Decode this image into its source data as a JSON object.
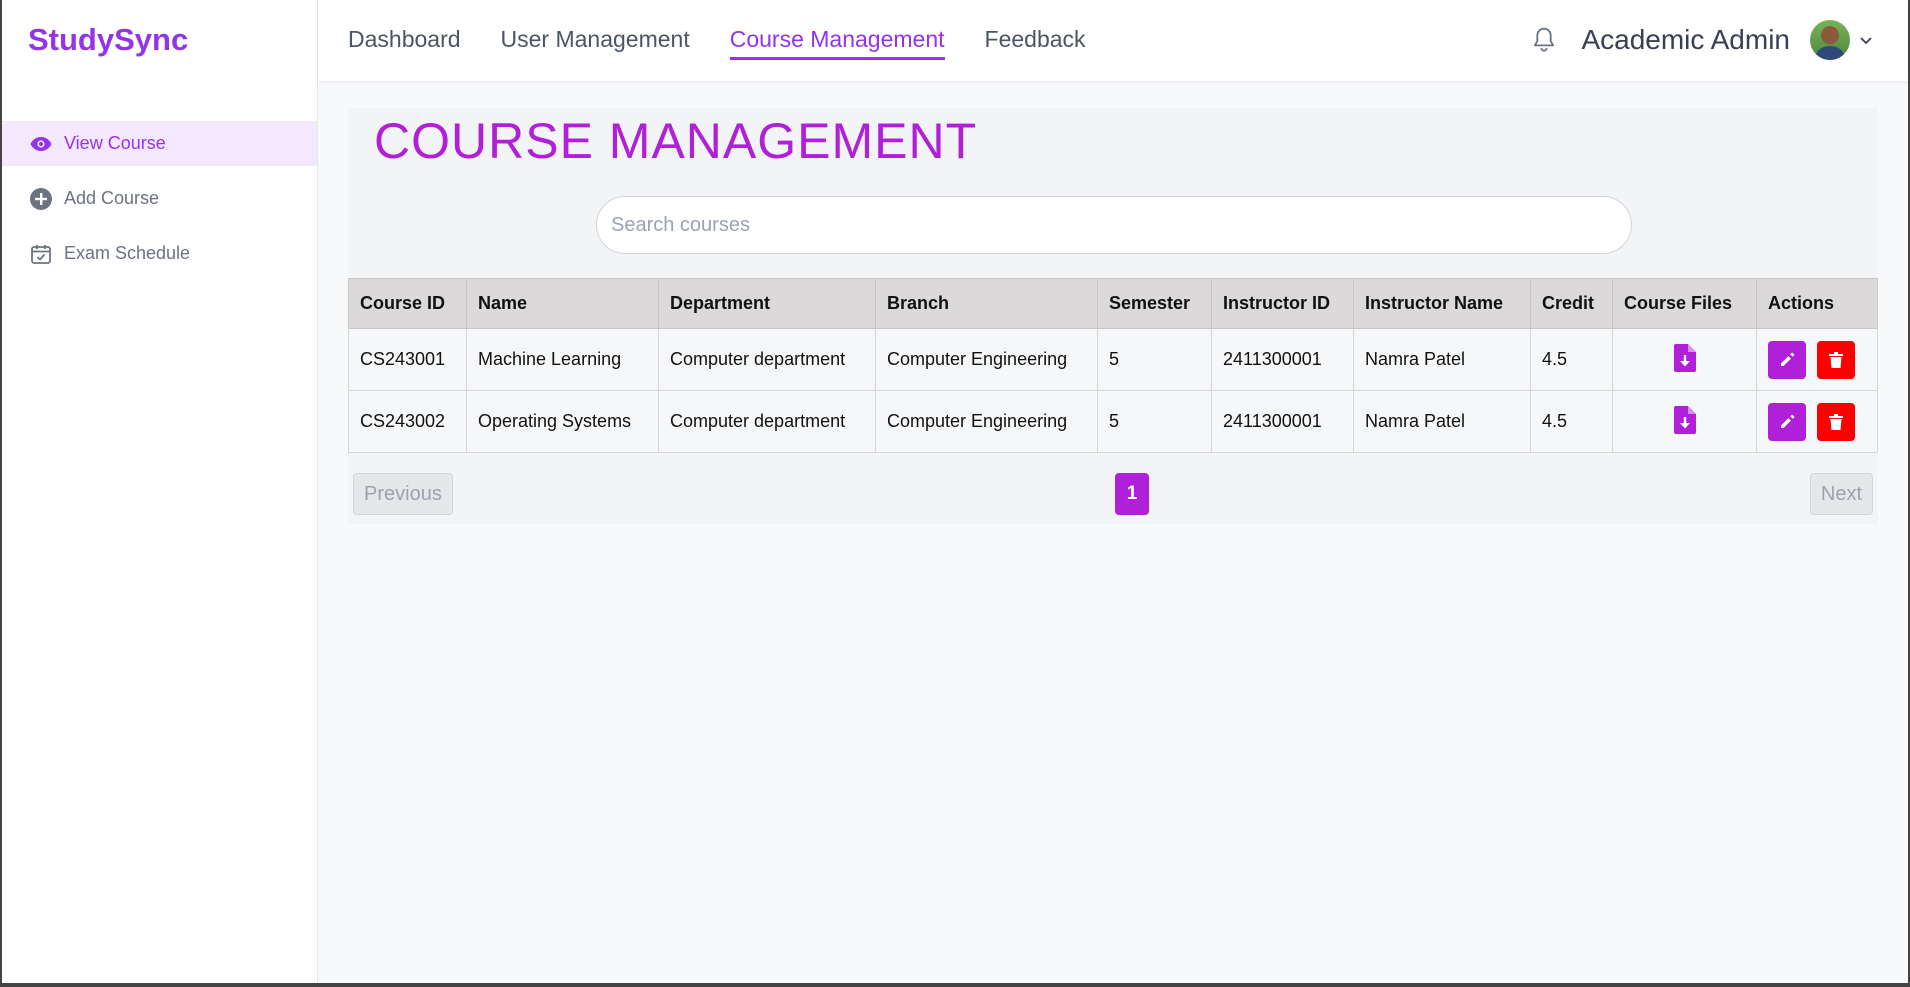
{
  "app": {
    "brand": "StudySync"
  },
  "sidebar": {
    "items": [
      {
        "label": "View Course",
        "icon": "eye-icon",
        "active": true
      },
      {
        "label": "Add Course",
        "icon": "plus-circle-icon",
        "active": false
      },
      {
        "label": "Exam Schedule",
        "icon": "calendar-check-icon",
        "active": false
      }
    ]
  },
  "nav": {
    "items": [
      {
        "label": "Dashboard",
        "active": false
      },
      {
        "label": "User Management",
        "active": false
      },
      {
        "label": "Course Management",
        "active": true
      },
      {
        "label": "Feedback",
        "active": false
      }
    ]
  },
  "header": {
    "user_name": "Academic Admin"
  },
  "main": {
    "title": "COURSE MANAGEMENT",
    "search": {
      "placeholder": "Search courses",
      "value": ""
    },
    "table": {
      "columns": [
        "Course ID",
        "Name",
        "Department",
        "Branch",
        "Semester",
        "Instructor ID",
        "Instructor Name",
        "Credit",
        "Course Files",
        "Actions"
      ],
      "rows": [
        {
          "course_id": "CS243001",
          "name": "Machine Learning",
          "department": "Computer department",
          "branch": "Computer Engineering",
          "semester": "5",
          "instructor_id": "2411300001",
          "instructor_name": "Namra Patel",
          "credit": "4.5"
        },
        {
          "course_id": "CS243002",
          "name": "Operating Systems",
          "department": "Computer department",
          "branch": "Computer Engineering",
          "semester": "5",
          "instructor_id": "2411300001",
          "instructor_name": "Namra Patel",
          "credit": "4.5"
        }
      ]
    },
    "pagination": {
      "previous": "Previous",
      "current_page": "1",
      "next": "Next"
    }
  },
  "colors": {
    "brand": "#9333ea",
    "accent": "#b020d8",
    "danger": "#ff0000",
    "active_bg": "#f3e8ff"
  }
}
